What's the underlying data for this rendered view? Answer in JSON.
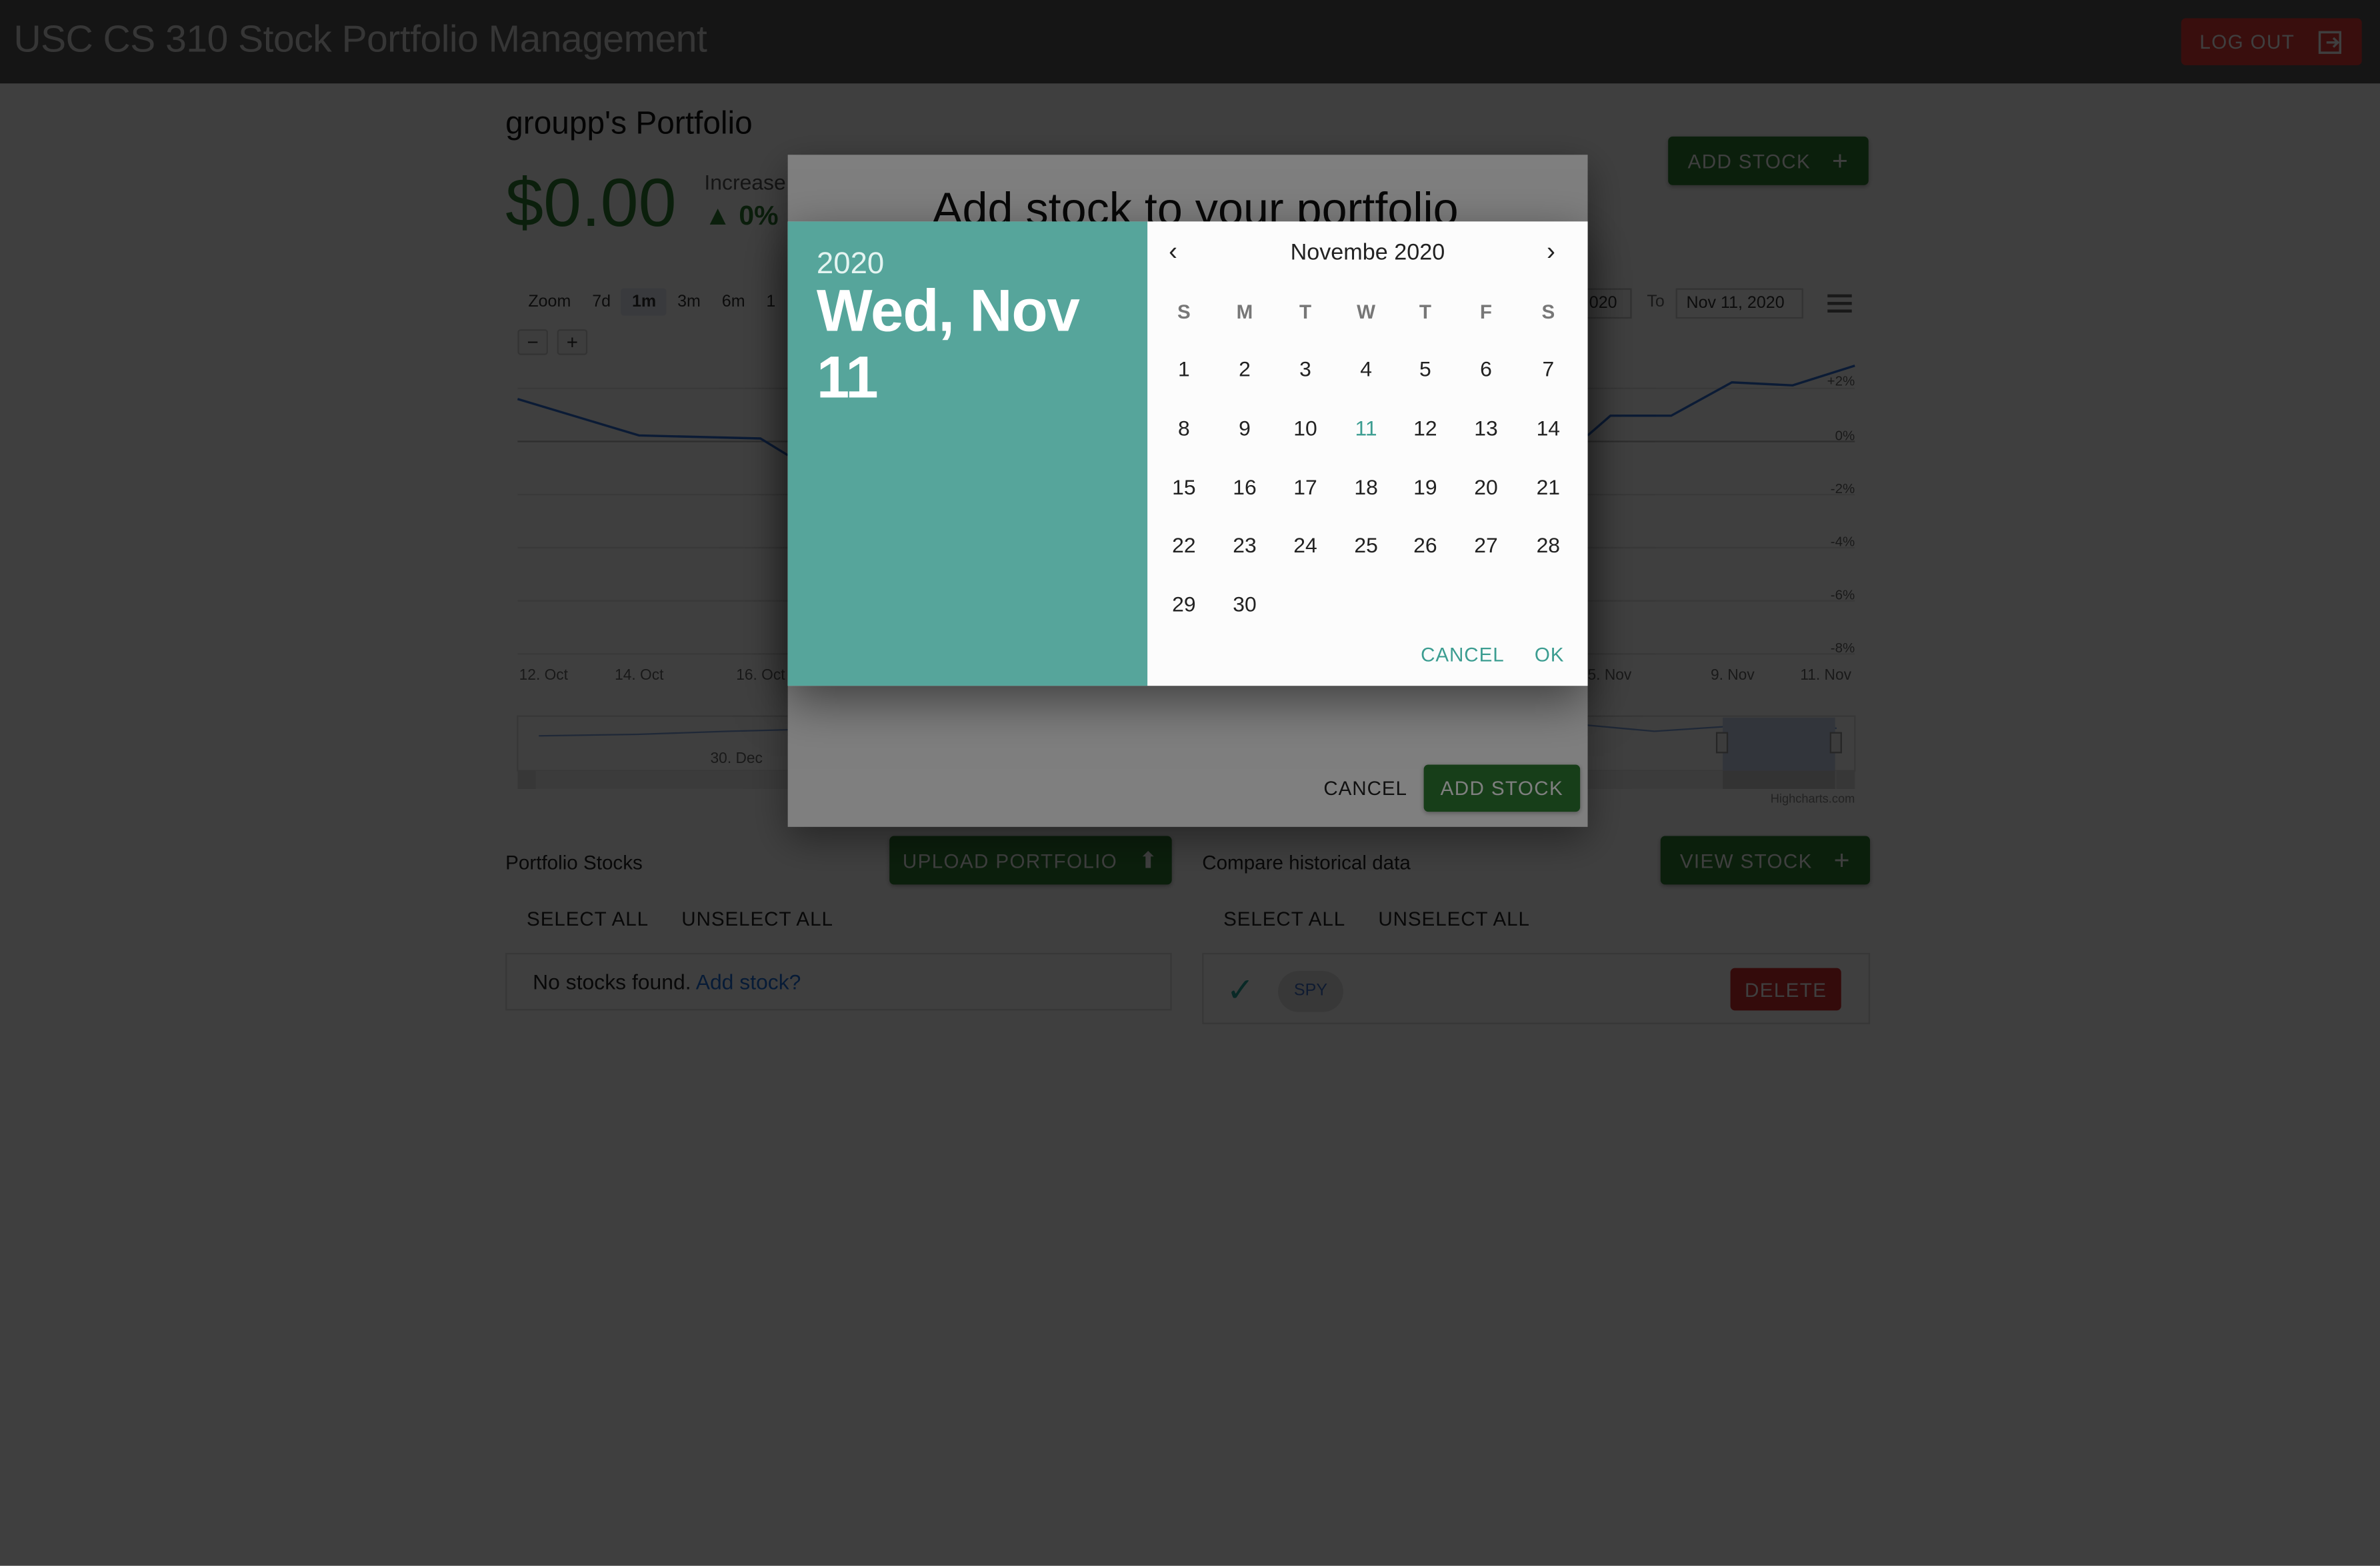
{
  "app": {
    "title": "USC CS 310 Stock Portfolio Management",
    "logout_label": "LOG OUT"
  },
  "portfolio": {
    "title": "groupp's Portfolio",
    "balance": "$0.00",
    "increase_label": "Increase",
    "increase_value": "▲ 0%",
    "add_stock_label": "ADD STOCK"
  },
  "chart_toolbar": {
    "zoom_label": "Zoom",
    "zoom_options": [
      "7d",
      "1m",
      "3m",
      "6m",
      "1"
    ],
    "selected": "1m",
    "from_value": "020",
    "to_label": "To",
    "to_value": "Nov 11, 2020"
  },
  "chart_data": {
    "type": "line",
    "x_ticks": [
      "12. Oct",
      "14. Oct",
      "16. Oct",
      "5. Nov",
      "9. Nov",
      "11. Nov"
    ],
    "y_ticks": [
      "+2%",
      "0%",
      "-2%",
      "-4%",
      "-6%",
      "-8%"
    ],
    "navigator_label": "30. Dec",
    "credit": "Highcharts.com"
  },
  "portfolio_stocks": {
    "label": "Portfolio Stocks",
    "upload_label": "UPLOAD PORTFOLIO",
    "select_all": "SELECT ALL",
    "unselect_all": "UNSELECT ALL",
    "empty_text": "No stocks found.",
    "empty_link": "Add stock?"
  },
  "historical": {
    "label": "Compare historical data",
    "view_label": "VIEW STOCK",
    "select_all": "SELECT ALL",
    "unselect_all": "UNSELECT ALL",
    "stock": "SPY",
    "delete_label": "DELETE"
  },
  "dialog": {
    "title": "Add stock to your portfolio",
    "cancel": "CANCEL",
    "add": "ADD STOCK"
  },
  "date_picker": {
    "year": "2020",
    "full_date": "Wed, Nov 11",
    "month_label": "Novembe  2020",
    "weekdays": [
      "S",
      "M",
      "T",
      "W",
      "T",
      "F",
      "S"
    ],
    "days": [
      "1",
      "2",
      "3",
      "4",
      "5",
      "6",
      "7",
      "8",
      "9",
      "10",
      "11",
      "12",
      "13",
      "14",
      "15",
      "16",
      "17",
      "18",
      "19",
      "20",
      "21",
      "22",
      "23",
      "24",
      "25",
      "26",
      "27",
      "28",
      "29",
      "30"
    ],
    "selected_day": "11",
    "cancel": "CANCEL",
    "ok": "OK"
  }
}
